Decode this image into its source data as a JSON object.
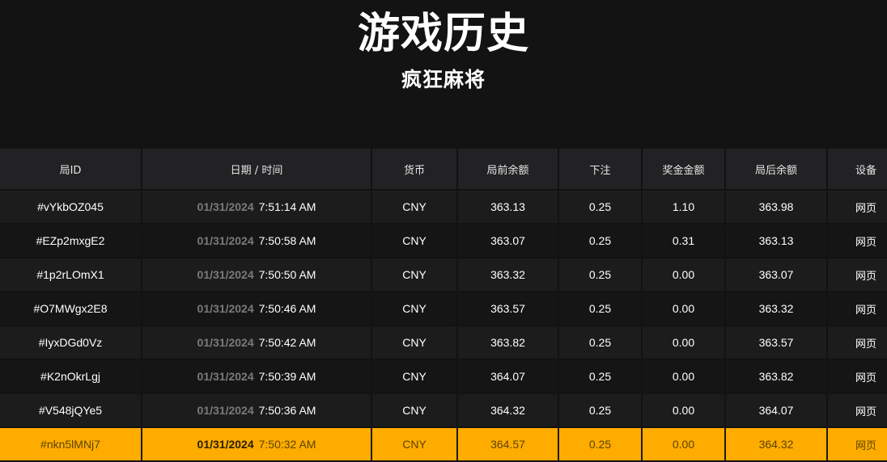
{
  "header": {
    "title": "游戏历史",
    "subtitle": "疯狂麻将"
  },
  "table": {
    "columns": [
      "局ID",
      "日期 / 时间",
      "货币",
      "局前余额",
      "下注",
      "奖金金额",
      "局后余额",
      "设备"
    ],
    "rows": [
      {
        "id": "#vYkbOZ045",
        "date": "01/31/2024",
        "time": "7:51:14 AM",
        "currency": "CNY",
        "before": "363.13",
        "bet": "0.25",
        "win": "1.10",
        "after": "363.98",
        "device": "网页"
      },
      {
        "id": "#EZp2mxgE2",
        "date": "01/31/2024",
        "time": "7:50:58 AM",
        "currency": "CNY",
        "before": "363.07",
        "bet": "0.25",
        "win": "0.31",
        "after": "363.13",
        "device": "网页"
      },
      {
        "id": "#1p2rLOmX1",
        "date": "01/31/2024",
        "time": "7:50:50 AM",
        "currency": "CNY",
        "before": "363.32",
        "bet": "0.25",
        "win": "0.00",
        "after": "363.07",
        "device": "网页"
      },
      {
        "id": "#O7MWgx2E8",
        "date": "01/31/2024",
        "time": "7:50:46 AM",
        "currency": "CNY",
        "before": "363.57",
        "bet": "0.25",
        "win": "0.00",
        "after": "363.32",
        "device": "网页"
      },
      {
        "id": "#IyxDGd0Vz",
        "date": "01/31/2024",
        "time": "7:50:42 AM",
        "currency": "CNY",
        "before": "363.82",
        "bet": "0.25",
        "win": "0.00",
        "after": "363.57",
        "device": "网页"
      },
      {
        "id": "#K2nOkrLgj",
        "date": "01/31/2024",
        "time": "7:50:39 AM",
        "currency": "CNY",
        "before": "364.07",
        "bet": "0.25",
        "win": "0.00",
        "after": "363.82",
        "device": "网页"
      },
      {
        "id": "#V548jQYe5",
        "date": "01/31/2024",
        "time": "7:50:36 AM",
        "currency": "CNY",
        "before": "364.32",
        "bet": "0.25",
        "win": "0.00",
        "after": "364.07",
        "device": "网页"
      },
      {
        "id": "#nkn5lMNj7",
        "date": "01/31/2024",
        "time": "7:50:32 AM",
        "currency": "CNY",
        "before": "364.57",
        "bet": "0.25",
        "win": "0.00",
        "after": "364.32",
        "device": "网页"
      }
    ]
  },
  "colors": {
    "background": "#131313",
    "header_row": "#222224",
    "highlight": "#ffac00"
  }
}
